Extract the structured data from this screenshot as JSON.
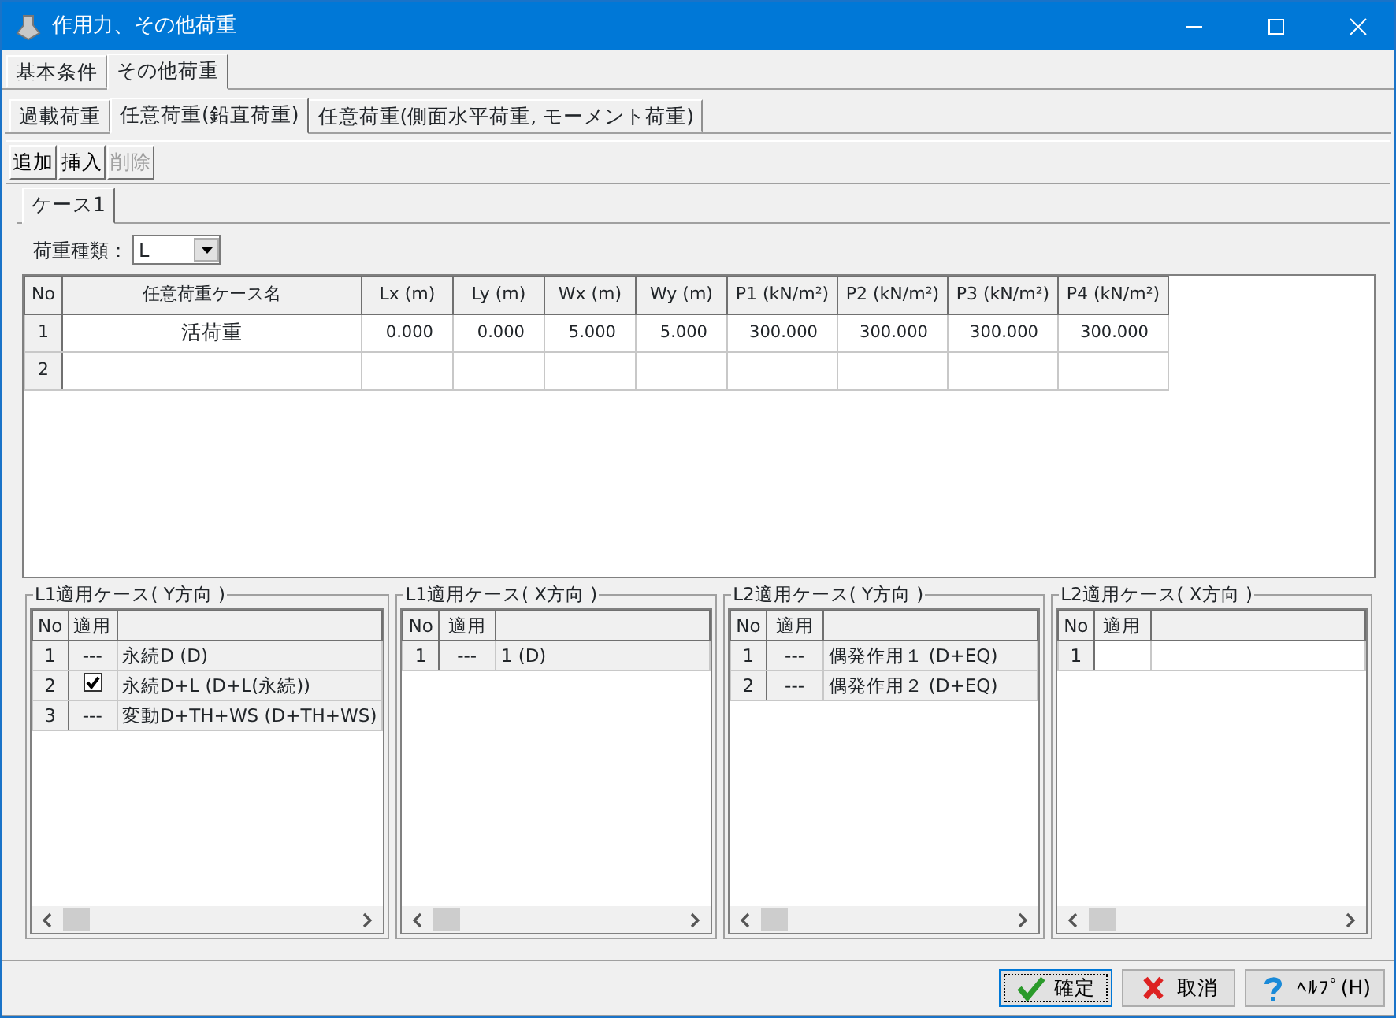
{
  "window": {
    "title": "作用力、その他荷重"
  },
  "tabs": [
    {
      "label": "基本条件",
      "selected": false
    },
    {
      "label": "その他荷重",
      "selected": true
    }
  ],
  "subtabs": [
    {
      "label": "過載荷重",
      "selected": false
    },
    {
      "label": "任意荷重(鉛直荷重)",
      "selected": true
    },
    {
      "label": "任意荷重(側面水平荷重, モーメント荷重)",
      "selected": false
    }
  ],
  "toolbar": [
    {
      "label": "追加",
      "disabled": false
    },
    {
      "label": "挿入",
      "disabled": false
    },
    {
      "label": "削除",
      "disabled": true
    }
  ],
  "case_tabs": [
    {
      "label": "ケース1",
      "selected": true
    }
  ],
  "load_type": {
    "label": "荷重種類：",
    "value": "L"
  },
  "table": {
    "columns": [
      "No",
      "任意荷重ケース名",
      "Lx (m)",
      "Ly (m)",
      "Wx (m)",
      "Wy (m)",
      "P1 (kN/m²)",
      "P2 (kN/m²)",
      "P3 (kN/m²)",
      "P4 (kN/m²)"
    ],
    "rows": [
      [
        "1",
        "活荷重",
        "0.000",
        "0.000",
        "5.000",
        "5.000",
        "300.000",
        "300.000",
        "300.000",
        "300.000"
      ],
      [
        "2",
        "",
        "",
        "",
        "",
        "",
        "",
        "",
        "",
        ""
      ]
    ]
  },
  "panels": [
    {
      "title": "L1適用ケース( Y方向 )",
      "columns": [
        "No",
        "適用"
      ],
      "rows": [
        {
          "no": "1",
          "apply": "---",
          "label": "永続D (D)"
        },
        {
          "no": "2",
          "checked": true,
          "label": "永続D+L (D+L(永続))"
        },
        {
          "no": "3",
          "apply": "---",
          "label": "変動D+TH+WS (D+TH+WS)"
        }
      ]
    },
    {
      "title": "L1適用ケース( X方向 )",
      "columns": [
        "No",
        "適用"
      ],
      "rows": [
        {
          "no": "1",
          "apply": "---",
          "label": "1 (D)"
        }
      ]
    },
    {
      "title": "L2適用ケース( Y方向 )",
      "columns": [
        "No",
        "適用"
      ],
      "rows": [
        {
          "no": "1",
          "apply": "---",
          "label": "偶発作用１ (D+EQ)"
        },
        {
          "no": "2",
          "apply": "---",
          "label": "偶発作用２ (D+EQ)"
        }
      ]
    },
    {
      "title": "L2適用ケース( X方向 )",
      "columns": [
        "No",
        "適用"
      ],
      "rows": [
        {
          "no": "1"
        }
      ]
    }
  ],
  "buttons": [
    {
      "kind": "ok",
      "label": "確定"
    },
    {
      "kind": "cancel",
      "label": "取消"
    },
    {
      "kind": "help",
      "label": "ﾍﾙﾌﾟ(H)"
    }
  ]
}
